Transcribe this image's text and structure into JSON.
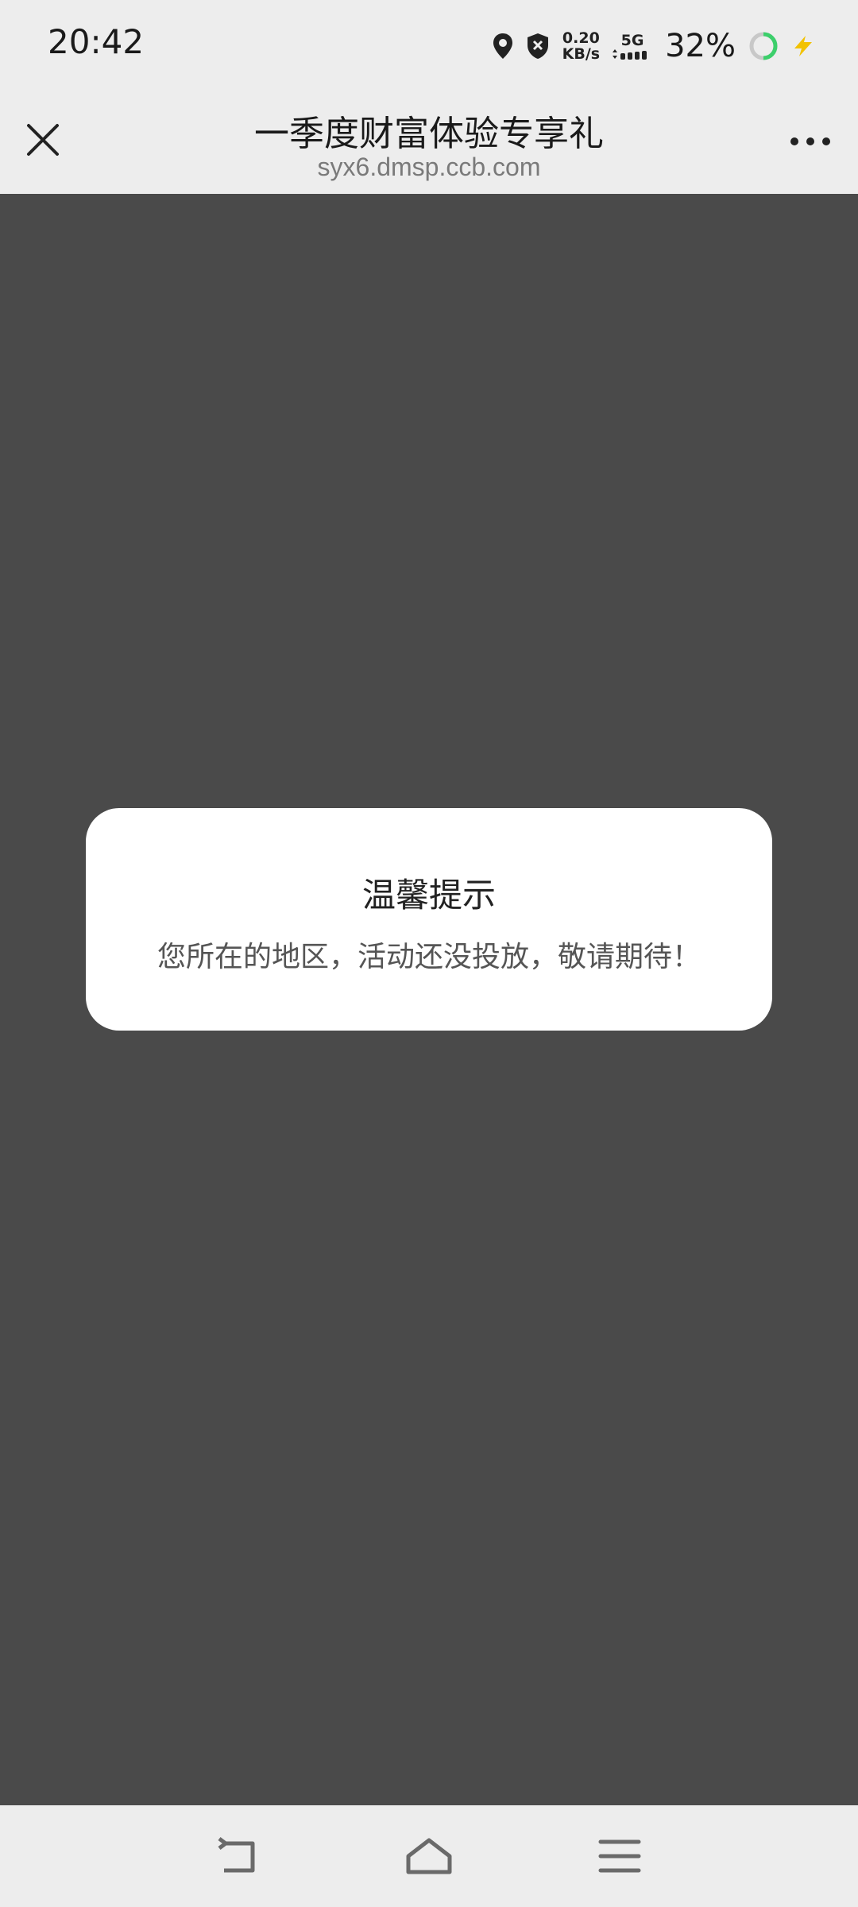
{
  "status_bar": {
    "time": "20:42",
    "net_speed_value": "0.20",
    "net_speed_unit": "KB/s",
    "network_type": "5G",
    "battery_percent": "32%",
    "icons": [
      "location-icon",
      "shield-icon",
      "signal-icon",
      "battery-ring-icon",
      "charging-icon"
    ]
  },
  "title_bar": {
    "title": "一季度财富体验专享礼",
    "url": "syx6.dmsp.ccb.com",
    "icons": [
      "close-icon",
      "more-icon"
    ]
  },
  "dialog": {
    "title": "温馨提示",
    "message": "您所在的地区，活动还没投放，敬请期待！"
  },
  "nav_bar": {
    "icons": [
      "back-icon",
      "home-icon",
      "menu-icon"
    ]
  },
  "colors": {
    "bars_background": "#ededed",
    "page_background": "#4a4a4a",
    "dialog_background": "#ffffff",
    "battery_ring": "#3ccf6b",
    "charging_bolt": "#f2c200"
  }
}
